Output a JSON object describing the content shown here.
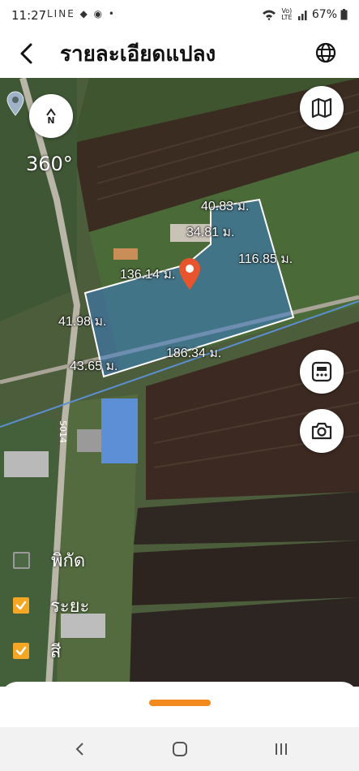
{
  "status_bar": {
    "time": "11:27",
    "notifications": "LINE ◆ ◉ •",
    "network": "Vo) LTE",
    "battery": "67%"
  },
  "header": {
    "title": "รายละเอียดแปลง"
  },
  "map": {
    "compass_label": "N",
    "view_label": "360°",
    "road_label": "5014",
    "distances": [
      "40.83 ม.",
      "34.81 ม.",
      "116.85 ม.",
      "136.14 ม.",
      "41.98 ม.",
      "43.65 ม.",
      "186.34 ม."
    ]
  },
  "layers": {
    "coordinates": {
      "label": "พิกัด",
      "checked": false
    },
    "distance": {
      "label": "ระยะ",
      "checked": true
    },
    "color": {
      "label": "สี",
      "checked": true
    }
  },
  "colors": {
    "accent": "#f5a623",
    "handle": "#f28a1e",
    "plot_fill": "#3d7cc9",
    "marker": "#e8542c"
  },
  "icons": [
    "back-arrow-icon",
    "globe-icon",
    "compass-icon",
    "map-layers-icon",
    "calculator-icon",
    "camera-icon",
    "location-pin-icon"
  ]
}
